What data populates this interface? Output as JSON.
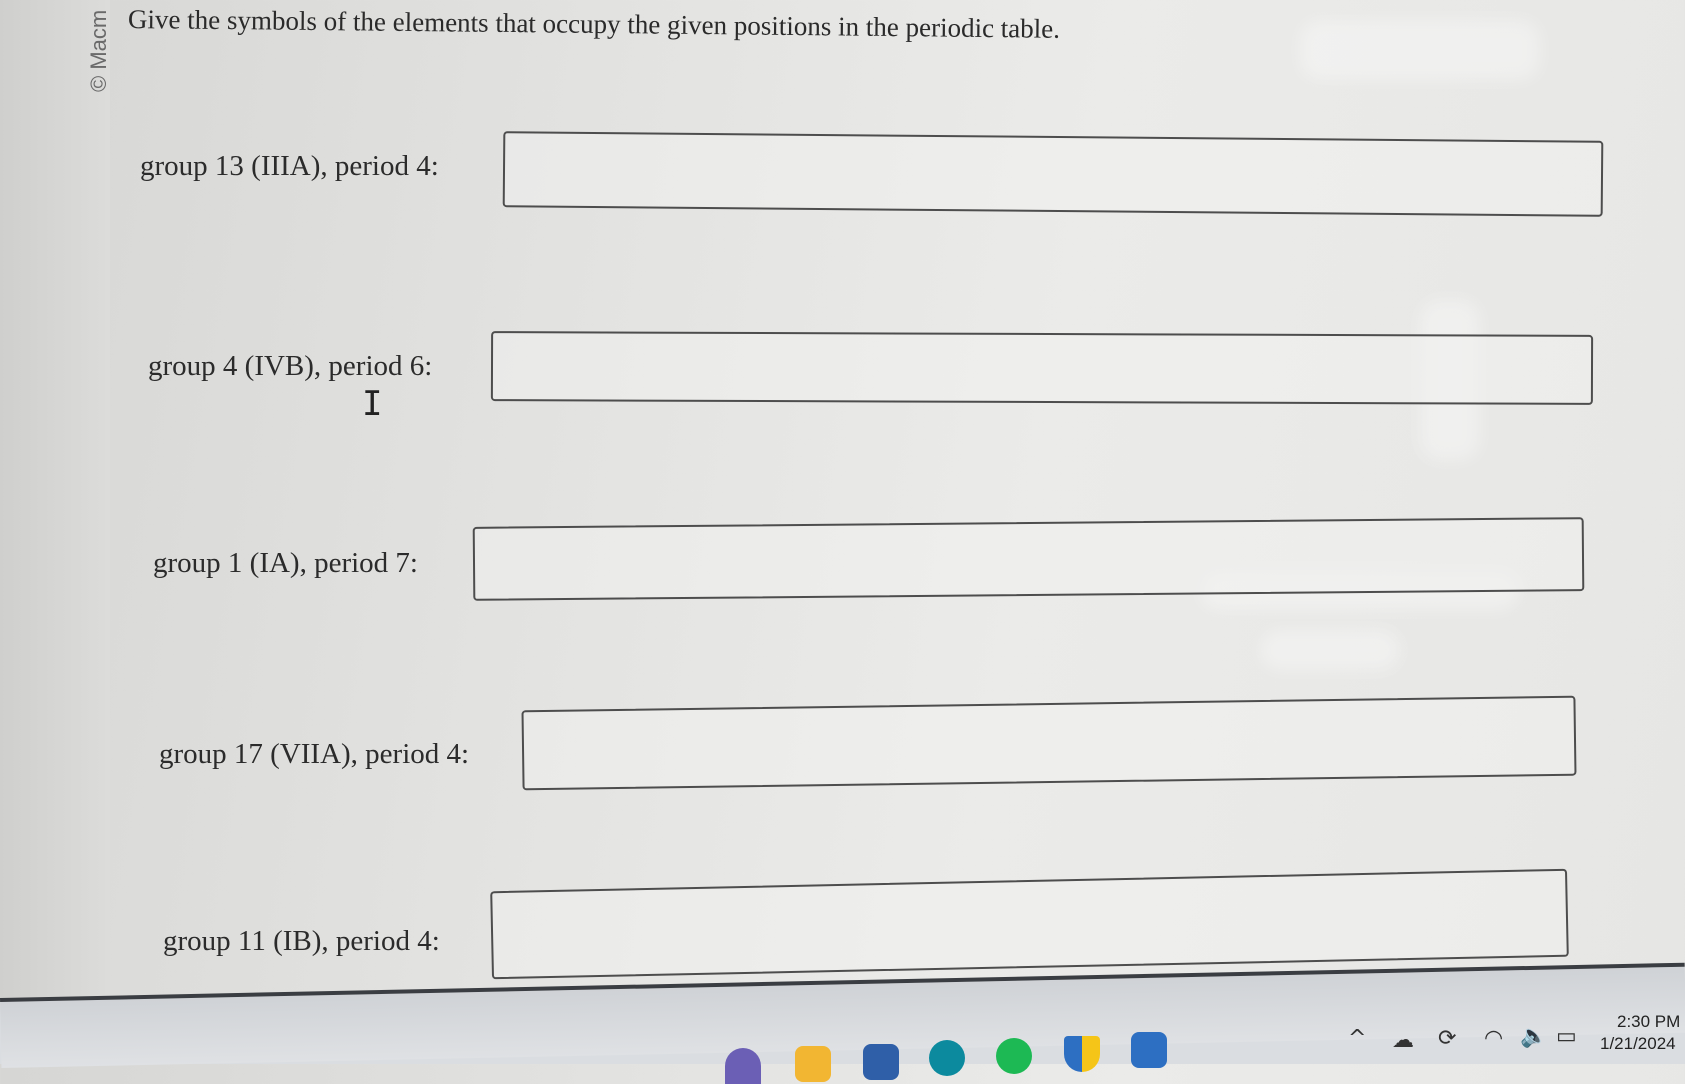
{
  "watermark": {
    "copyright": "© Macm"
  },
  "question": {
    "prompt": "Give the symbols of the elements that occupy the given positions in the periodic table."
  },
  "rows": [
    {
      "label": "group 13 (IIIA), period 4:",
      "value": ""
    },
    {
      "label": "group 4 (IVB), period 6:",
      "value": ""
    },
    {
      "label": "group 1 (IA), period 7:",
      "value": ""
    },
    {
      "label": "group 17 (VIIA), period 4:",
      "value": ""
    },
    {
      "label": "group 11 (IB), period 4:",
      "value": ""
    }
  ],
  "cursor": {
    "glyph": "I"
  },
  "taskbar": {
    "icons": [
      "chat-icon",
      "file-explorer-icon",
      "store-icon",
      "edge-icon",
      "spotify-icon",
      "security-shield-icon",
      "outlook-icon"
    ],
    "tray": {
      "chevron": "^",
      "time": "2:30 PM",
      "date": "1/21/2024"
    },
    "colors": {
      "spotify": "#1db954",
      "edge": "#0c8a9e",
      "explorer": "#f2b632",
      "store": "#2f5fa8",
      "outlook": "#2d6fc2",
      "shield_blue": "#2d6fc2",
      "shield_yellow": "#f5c518"
    }
  }
}
